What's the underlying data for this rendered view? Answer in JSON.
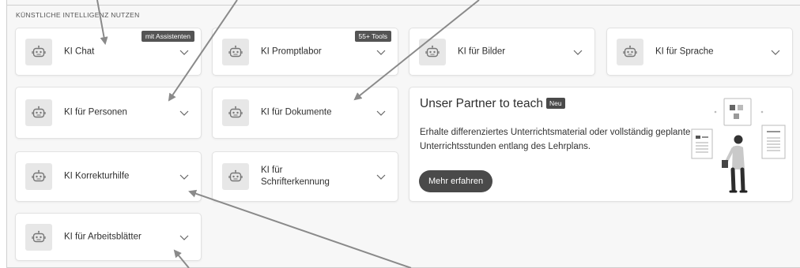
{
  "section": {
    "title": "Künstliche Intelligenz nutzen"
  },
  "cards": [
    {
      "label": "KI Chat",
      "badge": "mit Assistenten"
    },
    {
      "label": "KI Promptlabor",
      "badge": "55+ Tools"
    },
    {
      "label": "KI für Bilder"
    },
    {
      "label": "KI für Sprache"
    },
    {
      "label": "KI für Personen"
    },
    {
      "label": "KI für Dokumente"
    },
    {
      "label": "KI Korrekturhilfe"
    },
    {
      "label": "KI für Schrifterkennung"
    },
    {
      "label": "KI für Arbeitsblätter"
    }
  ],
  "partner": {
    "title": "Unser Partner to teach",
    "badge": "Neu",
    "description": "Erhalte differenziertes Unterrichtsmaterial oder vollständig geplante Unterrichtsstunden entlang des Lehrplans.",
    "cta": "Mehr erfahren"
  },
  "icons": {
    "card_icon": "robot-icon",
    "expand_icon": "chevron-down-icon"
  },
  "colors": {
    "badge": "#545454",
    "button": "#4a4a4a",
    "arrow": "#8a8a8a"
  }
}
